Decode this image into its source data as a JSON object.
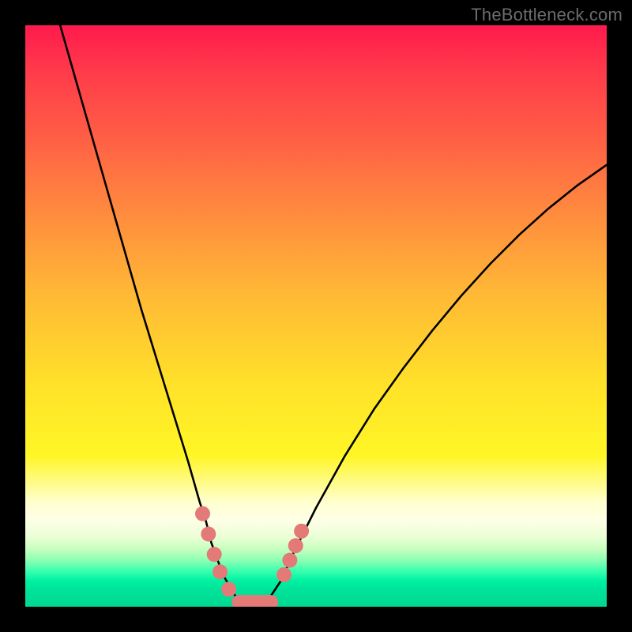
{
  "watermark": "TheBottleneck.com",
  "chart_data": {
    "type": "line",
    "title": "",
    "xlabel": "",
    "ylabel": "",
    "xlim": [
      0,
      100
    ],
    "ylim": [
      0,
      100
    ],
    "series": [
      {
        "name": "bottleneck-curve",
        "x": [
          6,
          8,
          10,
          12,
          14,
          16,
          18,
          20,
          22,
          24,
          26,
          28,
          30,
          31,
          32,
          34,
          36,
          38,
          40,
          42,
          44,
          46,
          50,
          55,
          60,
          65,
          70,
          75,
          80,
          85,
          90,
          95,
          100
        ],
        "y": [
          100,
          93,
          86,
          79,
          72,
          65,
          58,
          51,
          44.5,
          38,
          31.5,
          25,
          18,
          15,
          11,
          5.5,
          2,
          0.5,
          0.5,
          1.5,
          4.5,
          9,
          17,
          26,
          34,
          41,
          47.5,
          53.5,
          59,
          64,
          68.5,
          72.5,
          76
        ]
      }
    ],
    "markers": [
      {
        "name": "left-marker-cluster",
        "color": "#e47a78",
        "points": [
          {
            "x": 30.5,
            "y": 16
          },
          {
            "x": 31.5,
            "y": 12.5
          },
          {
            "x": 32.5,
            "y": 9
          },
          {
            "x": 33.5,
            "y": 6
          },
          {
            "x": 35.0,
            "y": 3
          }
        ]
      },
      {
        "name": "right-marker-cluster",
        "color": "#e47a78",
        "points": [
          {
            "x": 44.5,
            "y": 5.5
          },
          {
            "x": 45.5,
            "y": 8
          },
          {
            "x": 46.5,
            "y": 10.5
          },
          {
            "x": 47.5,
            "y": 13
          }
        ]
      },
      {
        "name": "bottom-bar",
        "color": "#e47a78",
        "shape": "rounded-segment",
        "x0": 35.5,
        "x1": 43.5,
        "y": 0.8
      }
    ]
  }
}
